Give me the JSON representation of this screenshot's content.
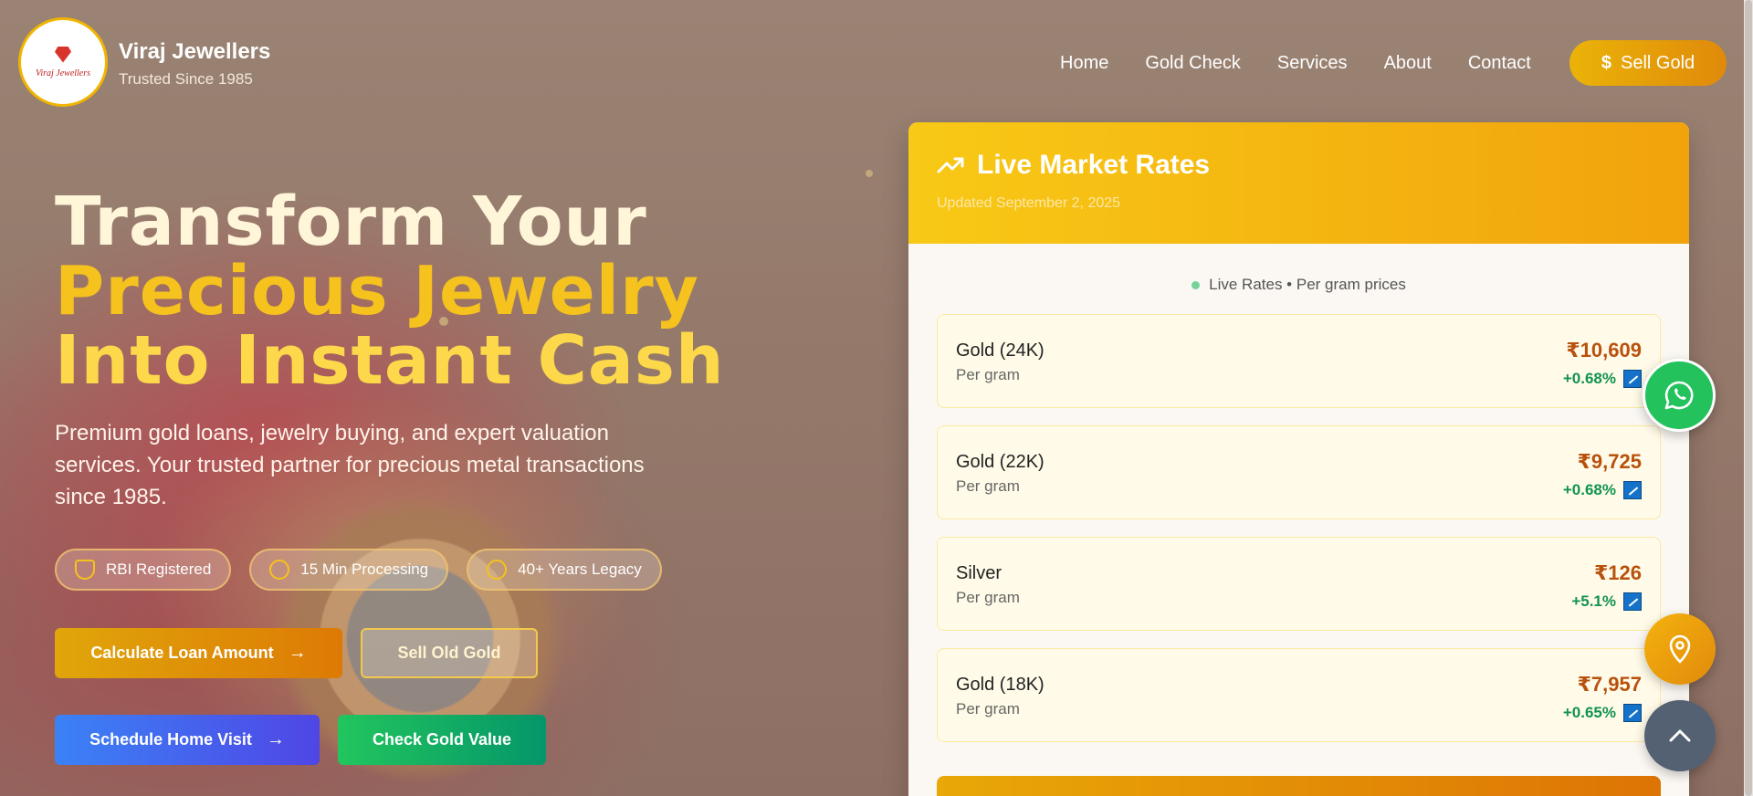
{
  "brand": {
    "logo_text": "Viraj Jewellers",
    "name": "Viraj Jewellers",
    "tagline": "Trusted Since 1985"
  },
  "nav": {
    "items": [
      "Home",
      "Gold Check",
      "Services",
      "About",
      "Contact"
    ],
    "sell_button": "Sell Gold"
  },
  "hero": {
    "line1": "Transform Your",
    "line2": "Precious Jewelry",
    "line3": "Into Instant Cash",
    "subtitle": "Premium gold loans, jewelry buying, and expert valuation services. Your trusted partner for precious metal transactions since 1985.",
    "badges": [
      "RBI Registered",
      "15 Min Processing",
      "40+ Years Legacy"
    ],
    "buttons": {
      "calculate": "Calculate Loan Amount",
      "sell_old": "Sell Old Gold",
      "schedule": "Schedule Home Visit",
      "check_value": "Check Gold Value"
    }
  },
  "rates": {
    "title": "Live Market Rates",
    "updated": "Updated September 2, 2025",
    "live_label": "Live Rates • Per gram prices",
    "items": [
      {
        "name": "Gold (24K)",
        "unit": "Per gram",
        "price": "₹10,609",
        "change": "+0.68%"
      },
      {
        "name": "Gold (22K)",
        "unit": "Per gram",
        "price": "₹9,725",
        "change": "+0.68%"
      },
      {
        "name": "Silver",
        "unit": "Per gram",
        "price": "₹126",
        "change": "+5.1%"
      },
      {
        "name": "Gold (18K)",
        "unit": "Per gram",
        "price": "₹7,957",
        "change": "+0.65%"
      }
    ]
  },
  "colors": {
    "accent_gold": "#f6c21d",
    "accent_orange": "#e08a0a",
    "price_color": "#b8510d",
    "positive": "#129350",
    "whatsapp": "#24c25d",
    "blue": "#3b82f6"
  },
  "icons": {
    "rates": "trending-up-icon",
    "whatsapp": "whatsapp-icon",
    "location": "map-pin-icon",
    "scroll_top": "chevron-up-icon"
  }
}
